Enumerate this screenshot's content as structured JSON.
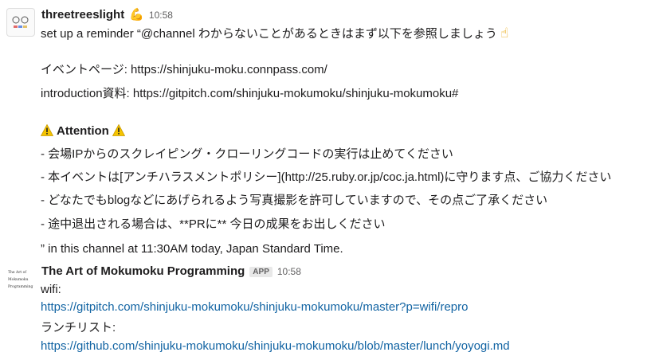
{
  "message1": {
    "author": "threetreeslight",
    "author_emoji": "💪",
    "time": "10:58",
    "line_intro": "set up a reminder “@channel わからないことがあるときはまず以下を参照しましょう",
    "pointing_emoji": "☝",
    "event_page_label": "イベントページ: ",
    "event_page_url": "https://shinjuku-moku.connpass.com/",
    "intro_label": "introduction資料: ",
    "intro_url": "https://gitpitch.com/shinjuku-mokumoku/shinjuku-mokumoku#",
    "attention": "Attention",
    "rules": [
      "- 会場IPからのスクレイピング・クローリングコードの実行は止めてください",
      "- 本イベントは[アンチハラスメントポリシー](http://25.ruby.or.jp/coc.ja.html)に守ります点、ご協力ください",
      "- どなたでもblogなどにあげられるよう写真撮影を許可していますので、その点ご了承ください",
      "- 途中退出される場合は、**PRに** 今日の成果をお出しください"
    ],
    "reminder_tail": "” in this channel at 11:30AM today, Japan Standard Time."
  },
  "message2": {
    "author": "The Art of Mokumoku Programming",
    "badge": "APP",
    "time": "10:58",
    "avatar_logo_lines": [
      "The Art of",
      "Mokumoku",
      "Programming"
    ],
    "wifi_label": "wifi:",
    "wifi_url": "https://gitpitch.com/shinjuku-mokumoku/shinjuku-mokumoku/master?p=wifi/repro",
    "lunch_label": "ランチリスト:",
    "lunch_url": "https://github.com/shinjuku-mokumoku/shinjuku-mokumoku/blob/master/lunch/yoyogi.md"
  },
  "colors": {
    "link": "#1264a3",
    "text": "#1d1c1d",
    "muted": "#616061",
    "warning": "#f5c400"
  },
  "icons": [
    "avatar-threetreeslight",
    "flexed-biceps-icon",
    "pointing-up-icon",
    "warning-icon",
    "app-avatar-logo"
  ]
}
